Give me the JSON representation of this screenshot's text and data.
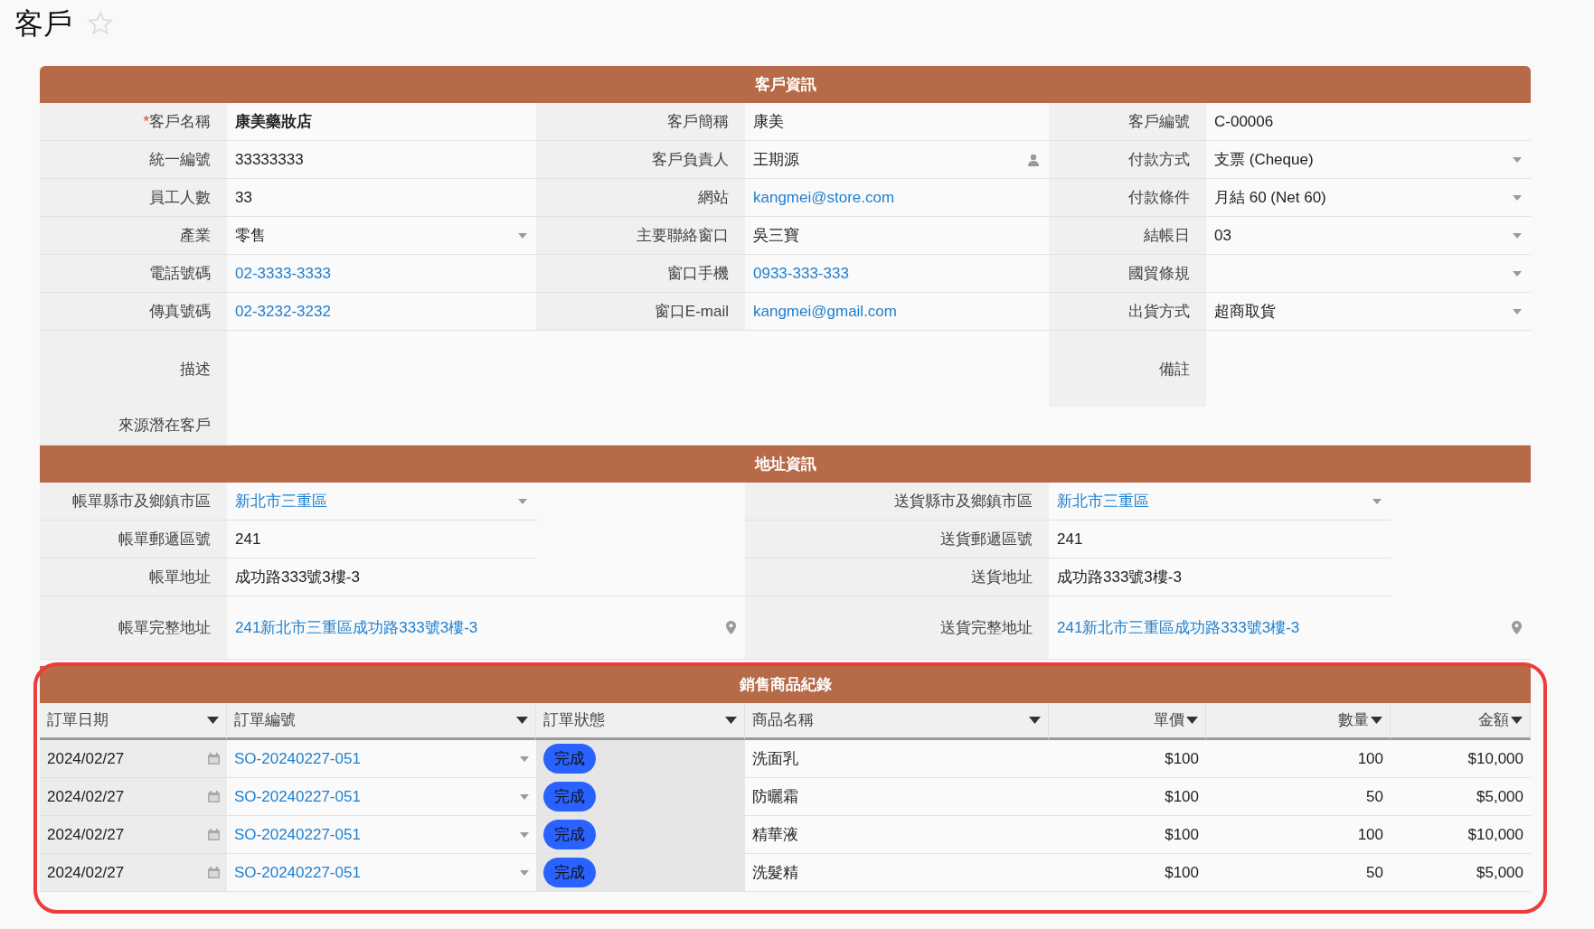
{
  "page": {
    "title": "客戶"
  },
  "customer_info": {
    "title": "客戶資訊",
    "rows": [
      [
        {
          "label": "客戶名稱",
          "required_mark": "*",
          "value": "康美藥妝店",
          "kind": "text",
          "link": false,
          "bold": true
        },
        {
          "label": "客戶簡稱",
          "value": "康美",
          "kind": "text",
          "link": false,
          "bold": false
        },
        {
          "label": "客戶編號",
          "value": "C-00006",
          "kind": "text",
          "link": false,
          "bold": false
        }
      ],
      [
        {
          "label": "統一編號",
          "value": "33333333",
          "kind": "text",
          "link": false,
          "bold": false
        },
        {
          "label": "客戶負責人",
          "value": "王期源",
          "kind": "person",
          "link": false,
          "bold": false
        },
        {
          "label": "付款方式",
          "value": "支票 (Cheque)",
          "kind": "dropdown",
          "link": false,
          "bold": false
        }
      ],
      [
        {
          "label": "員工人數",
          "value": "33",
          "kind": "text",
          "link": false,
          "bold": false
        },
        {
          "label": "網站",
          "value": "kangmei@store.com",
          "kind": "text",
          "link": true,
          "bold": false
        },
        {
          "label": "付款條件",
          "value": "月結 60 (Net 60)",
          "kind": "dropdown",
          "link": false,
          "bold": false
        }
      ],
      [
        {
          "label": "產業",
          "value": "零售",
          "kind": "dropdown",
          "link": false,
          "bold": false
        },
        {
          "label": "主要聯絡窗口",
          "value": "吳三寶",
          "kind": "text",
          "link": false,
          "bold": false
        },
        {
          "label": "結帳日",
          "value": "03",
          "kind": "dropdown",
          "link": false,
          "bold": false
        }
      ],
      [
        {
          "label": "電話號碼",
          "value": "02-3333-3333",
          "kind": "text",
          "link": true,
          "bold": false
        },
        {
          "label": "窗口手機",
          "value": "0933-333-333",
          "kind": "text",
          "link": true,
          "bold": false
        },
        {
          "label": "國貿條規",
          "kind": "dropdown"
        }
      ],
      [
        {
          "label": "傳真號碼",
          "value": "02-3232-3232",
          "kind": "text",
          "link": true,
          "bold": false
        },
        {
          "label": "窗口E-mail",
          "value": "kangmei@gmail.com",
          "kind": "text",
          "link": true,
          "bold": false
        },
        {
          "label": "出貨方式",
          "value": "超商取貨",
          "kind": "dropdown",
          "link": false,
          "bold": false
        }
      ]
    ],
    "description": {
      "label": "描述"
    },
    "remarks": {
      "label": "備註"
    },
    "source_lead": {
      "label": "來源潛在客戶"
    }
  },
  "address_info": {
    "title": "地址資訊",
    "rows": [
      [
        {
          "label": "帳單縣市及鄉鎮市區",
          "value": "新北市三重區",
          "kind": "dropdown",
          "link": true
        },
        {
          "label": "送貨縣市及鄉鎮市區",
          "value": "新北市三重區",
          "kind": "dropdown",
          "link": true
        }
      ],
      [
        {
          "label": "帳單郵遞區號",
          "value": "241",
          "kind": "text",
          "link": false
        },
        {
          "label": "送貨郵遞區號",
          "value": "241",
          "kind": "text",
          "link": false
        }
      ],
      [
        {
          "label": "帳單地址",
          "value": "成功路333號3樓-3",
          "kind": "text",
          "link": false
        },
        {
          "label": "送貨地址",
          "value": "成功路333號3樓-3",
          "kind": "text",
          "link": false
        }
      ],
      [
        {
          "label": "帳單完整地址",
          "value": "241新北市三重區成功路333號3樓-3",
          "kind": "map",
          "link": true
        },
        {
          "label": "送貨完整地址",
          "value": "241新北市三重區成功路333號3樓-3",
          "kind": "map",
          "link": true
        }
      ]
    ]
  },
  "sales_records": {
    "title": "銷售商品紀錄",
    "columns": [
      {
        "label": "訂單日期"
      },
      {
        "label": "訂單編號"
      },
      {
        "label": "訂單狀態"
      },
      {
        "label": "商品名稱"
      },
      {
        "label": "單價"
      },
      {
        "label": "數量"
      },
      {
        "label": "金額"
      }
    ],
    "rows": [
      {
        "date": "2024/02/27",
        "order_no": "SO-20240227-051",
        "status": "完成",
        "product": "洗面乳",
        "unit_price": "$100",
        "quantity": "100",
        "amount": "$10,000"
      },
      {
        "date": "2024/02/27",
        "order_no": "SO-20240227-051",
        "status": "完成",
        "product": "防曬霜",
        "unit_price": "$100",
        "quantity": "50",
        "amount": "$5,000"
      },
      {
        "date": "2024/02/27",
        "order_no": "SO-20240227-051",
        "status": "完成",
        "product": "精華液",
        "unit_price": "$100",
        "quantity": "100",
        "amount": "$10,000"
      },
      {
        "date": "2024/02/27",
        "order_no": "SO-20240227-051",
        "status": "完成",
        "product": "洗髮精",
        "unit_price": "$100",
        "quantity": "50",
        "amount": "$5,000"
      }
    ]
  }
}
